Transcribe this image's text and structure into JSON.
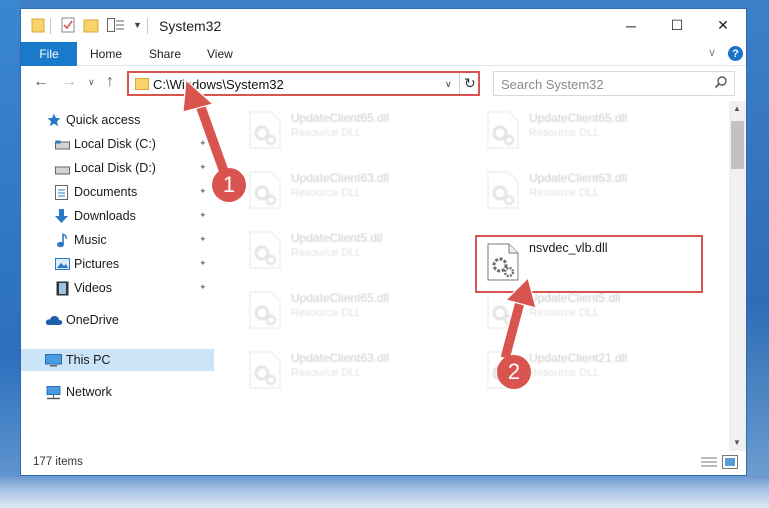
{
  "window": {
    "title": "System32",
    "controls": {
      "minimize": "─",
      "maximize": "☐",
      "close": "✕"
    }
  },
  "ribbon": {
    "tabs": [
      {
        "label": "File",
        "active": true
      },
      {
        "label": "Home"
      },
      {
        "label": "Share"
      },
      {
        "label": "View"
      }
    ],
    "expand_glyph": "∨",
    "help_glyph": "?"
  },
  "navigation": {
    "back_glyph": "←",
    "forward_glyph": "→",
    "recent_glyph": "∨",
    "up_glyph": "↑",
    "address": "C:\\Windows\\System32",
    "address_dropdown_glyph": "∨",
    "refresh_glyph": "↻",
    "search_placeholder": "Search System32"
  },
  "sidebar": {
    "items": [
      {
        "label": "Quick access",
        "icon": "star-icon"
      },
      {
        "label": "Local Disk (C:)",
        "icon": "drive-icon",
        "pinned": true
      },
      {
        "label": "Local Disk (D:)",
        "icon": "drive-icon",
        "pinned": true
      },
      {
        "label": "Documents",
        "icon": "documents-icon",
        "pinned": true
      },
      {
        "label": "Downloads",
        "icon": "downloads-icon",
        "pinned": true
      },
      {
        "label": "Music",
        "icon": "music-icon",
        "pinned": true
      },
      {
        "label": "Pictures",
        "icon": "pictures-icon",
        "pinned": true
      },
      {
        "label": "Videos",
        "icon": "videos-icon",
        "pinned": true
      },
      {
        "label": "OneDrive",
        "icon": "cloud-icon"
      },
      {
        "label": "This PC",
        "icon": "computer-icon",
        "selected": true
      },
      {
        "label": "Network",
        "icon": "network-icon"
      }
    ],
    "pin_glyph": "✦"
  },
  "files": [
    {
      "name": "UpdateClient65.dll",
      "type": "Resource DLL",
      "faded": true
    },
    {
      "name": "UpdateClient65.dll",
      "type": "Resource DLL",
      "faded": true
    },
    {
      "name": "UpdateClient63.dll",
      "type": "Resource DLL",
      "faded": true
    },
    {
      "name": "UpdateClient63.dll",
      "type": "Resource DLL",
      "faded": true
    },
    {
      "name": "UpdateClient5.dll",
      "type": "Resource DLL",
      "faded": true
    },
    {
      "name": "nsvdec_vlb.dll",
      "type": "",
      "faded": false,
      "highlighted": true
    },
    {
      "name": "UpdateClient65.dll",
      "type": "Resource DLL",
      "faded": true
    },
    {
      "name": "UpdateClient5.dll",
      "type": "Resource DLL",
      "faded": true
    },
    {
      "name": "UpdateClient63.dll",
      "type": "Resource DLL",
      "faded": true
    },
    {
      "name": "UpdateClient21.dll",
      "type": "Resource DLL",
      "faded": true
    }
  ],
  "scrollbar": {
    "up_glyph": "▲",
    "down_glyph": "▼"
  },
  "status": {
    "item_count": "177 items"
  },
  "annotations": {
    "step1": "1",
    "step2": "2",
    "color": "#d9534f"
  }
}
